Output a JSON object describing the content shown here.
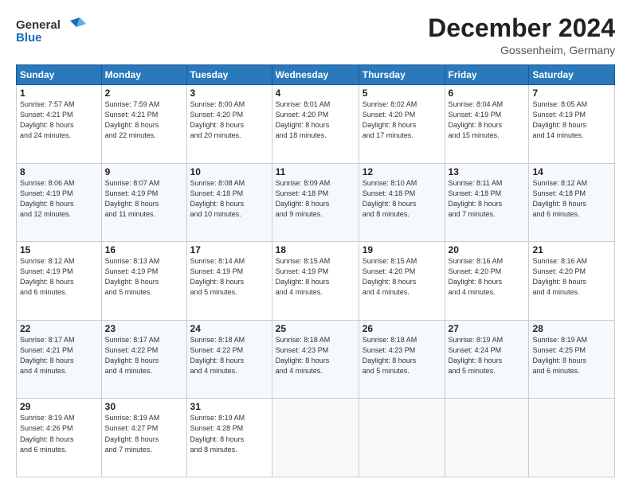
{
  "header": {
    "logo_line1": "General",
    "logo_line2": "Blue",
    "month": "December 2024",
    "location": "Gossenheim, Germany"
  },
  "weekdays": [
    "Sunday",
    "Monday",
    "Tuesday",
    "Wednesday",
    "Thursday",
    "Friday",
    "Saturday"
  ],
  "weeks": [
    [
      {
        "day": "1",
        "info": "Sunrise: 7:57 AM\nSunset: 4:21 PM\nDaylight: 8 hours\nand 24 minutes."
      },
      {
        "day": "2",
        "info": "Sunrise: 7:59 AM\nSunset: 4:21 PM\nDaylight: 8 hours\nand 22 minutes."
      },
      {
        "day": "3",
        "info": "Sunrise: 8:00 AM\nSunset: 4:20 PM\nDaylight: 8 hours\nand 20 minutes."
      },
      {
        "day": "4",
        "info": "Sunrise: 8:01 AM\nSunset: 4:20 PM\nDaylight: 8 hours\nand 18 minutes."
      },
      {
        "day": "5",
        "info": "Sunrise: 8:02 AM\nSunset: 4:20 PM\nDaylight: 8 hours\nand 17 minutes."
      },
      {
        "day": "6",
        "info": "Sunrise: 8:04 AM\nSunset: 4:19 PM\nDaylight: 8 hours\nand 15 minutes."
      },
      {
        "day": "7",
        "info": "Sunrise: 8:05 AM\nSunset: 4:19 PM\nDaylight: 8 hours\nand 14 minutes."
      }
    ],
    [
      {
        "day": "8",
        "info": "Sunrise: 8:06 AM\nSunset: 4:19 PM\nDaylight: 8 hours\nand 12 minutes."
      },
      {
        "day": "9",
        "info": "Sunrise: 8:07 AM\nSunset: 4:19 PM\nDaylight: 8 hours\nand 11 minutes."
      },
      {
        "day": "10",
        "info": "Sunrise: 8:08 AM\nSunset: 4:18 PM\nDaylight: 8 hours\nand 10 minutes."
      },
      {
        "day": "11",
        "info": "Sunrise: 8:09 AM\nSunset: 4:18 PM\nDaylight: 8 hours\nand 9 minutes."
      },
      {
        "day": "12",
        "info": "Sunrise: 8:10 AM\nSunset: 4:18 PM\nDaylight: 8 hours\nand 8 minutes."
      },
      {
        "day": "13",
        "info": "Sunrise: 8:11 AM\nSunset: 4:18 PM\nDaylight: 8 hours\nand 7 minutes."
      },
      {
        "day": "14",
        "info": "Sunrise: 8:12 AM\nSunset: 4:18 PM\nDaylight: 8 hours\nand 6 minutes."
      }
    ],
    [
      {
        "day": "15",
        "info": "Sunrise: 8:12 AM\nSunset: 4:19 PM\nDaylight: 8 hours\nand 6 minutes."
      },
      {
        "day": "16",
        "info": "Sunrise: 8:13 AM\nSunset: 4:19 PM\nDaylight: 8 hours\nand 5 minutes."
      },
      {
        "day": "17",
        "info": "Sunrise: 8:14 AM\nSunset: 4:19 PM\nDaylight: 8 hours\nand 5 minutes."
      },
      {
        "day": "18",
        "info": "Sunrise: 8:15 AM\nSunset: 4:19 PM\nDaylight: 8 hours\nand 4 minutes."
      },
      {
        "day": "19",
        "info": "Sunrise: 8:15 AM\nSunset: 4:20 PM\nDaylight: 8 hours\nand 4 minutes."
      },
      {
        "day": "20",
        "info": "Sunrise: 8:16 AM\nSunset: 4:20 PM\nDaylight: 8 hours\nand 4 minutes."
      },
      {
        "day": "21",
        "info": "Sunrise: 8:16 AM\nSunset: 4:20 PM\nDaylight: 8 hours\nand 4 minutes."
      }
    ],
    [
      {
        "day": "22",
        "info": "Sunrise: 8:17 AM\nSunset: 4:21 PM\nDaylight: 8 hours\nand 4 minutes."
      },
      {
        "day": "23",
        "info": "Sunrise: 8:17 AM\nSunset: 4:22 PM\nDaylight: 8 hours\nand 4 minutes."
      },
      {
        "day": "24",
        "info": "Sunrise: 8:18 AM\nSunset: 4:22 PM\nDaylight: 8 hours\nand 4 minutes."
      },
      {
        "day": "25",
        "info": "Sunrise: 8:18 AM\nSunset: 4:23 PM\nDaylight: 8 hours\nand 4 minutes."
      },
      {
        "day": "26",
        "info": "Sunrise: 8:18 AM\nSunset: 4:23 PM\nDaylight: 8 hours\nand 5 minutes."
      },
      {
        "day": "27",
        "info": "Sunrise: 8:19 AM\nSunset: 4:24 PM\nDaylight: 8 hours\nand 5 minutes."
      },
      {
        "day": "28",
        "info": "Sunrise: 8:19 AM\nSunset: 4:25 PM\nDaylight: 8 hours\nand 6 minutes."
      }
    ],
    [
      {
        "day": "29",
        "info": "Sunrise: 8:19 AM\nSunset: 4:26 PM\nDaylight: 8 hours\nand 6 minutes."
      },
      {
        "day": "30",
        "info": "Sunrise: 8:19 AM\nSunset: 4:27 PM\nDaylight: 8 hours\nand 7 minutes."
      },
      {
        "day": "31",
        "info": "Sunrise: 8:19 AM\nSunset: 4:28 PM\nDaylight: 8 hours\nand 8 minutes."
      },
      null,
      null,
      null,
      null
    ]
  ]
}
